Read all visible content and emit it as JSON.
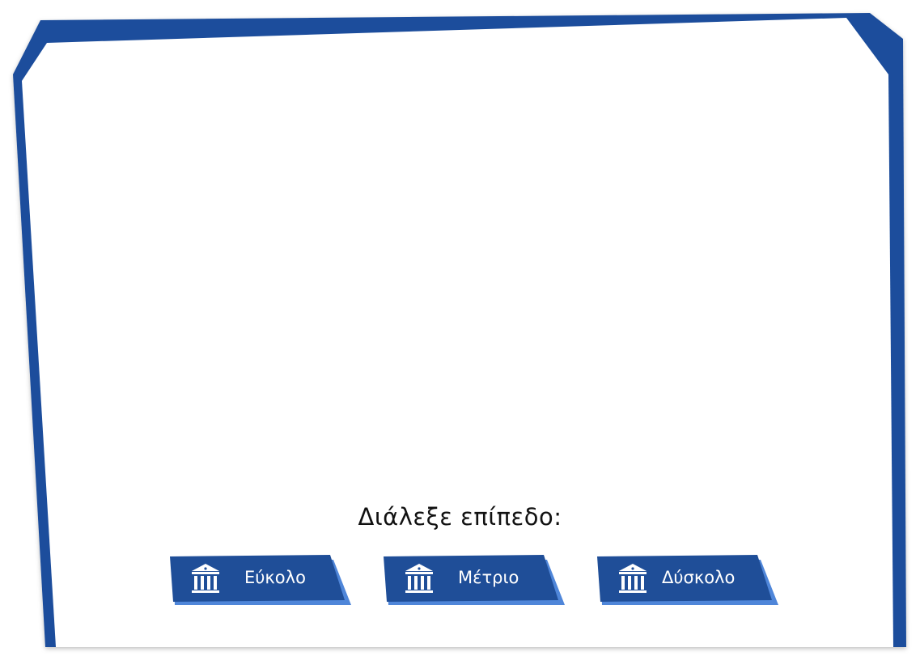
{
  "prompt": "Διάλεξε επίπεδο:",
  "levels": [
    {
      "label": "Εύκολο",
      "icon": "museum-icon"
    },
    {
      "label": "Μέτριο",
      "icon": "museum-icon"
    },
    {
      "label": "Δύσκολο",
      "icon": "museum-icon"
    }
  ],
  "colors": {
    "frame": "#1d4e9c",
    "button": "#1f4e98",
    "button_shadow": "#4f86d9",
    "background": "#ffffff"
  }
}
